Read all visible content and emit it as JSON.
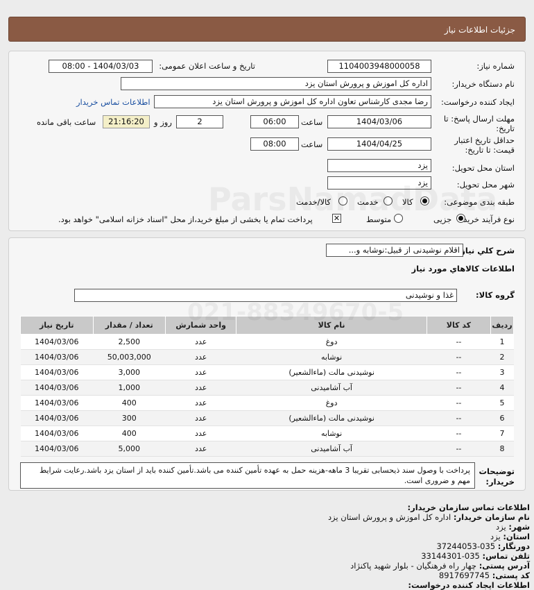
{
  "header": {
    "title": "جزئیات اطلاعات نیاز"
  },
  "form": {
    "need_number_label": "شماره نیاز:",
    "need_number": "1104003948000058",
    "announce_label": "تاریخ و ساعت اعلان عمومی:",
    "announce_value": "1404/03/03 - 08:00",
    "buyer_org_label": "نام دستگاه خریدار:",
    "buyer_org": "اداره کل اموزش و پرورش استان یزد",
    "creator_label": "ایجاد کننده درخواست:",
    "creator": "رضا مجدی کارشناس تعاون اداره کل اموزش و پرورش استان یزد",
    "contact_link": "اطلاعات تماس خریدار",
    "deadline_label_1": "مهلت ارسال پاسخ: تا",
    "deadline_label_2": "تاریخ:",
    "deadline_date": "1404/03/06",
    "time_label": "ساعت",
    "deadline_time": "06:00",
    "days": "2",
    "days_label": "روز و",
    "remaining": "21:16:20",
    "remaining_label": "ساعت باقی مانده",
    "validity_label_1": "حداقل تاریخ اعتبار",
    "validity_label_2": "قیمت: تا تاریخ:",
    "validity_date": "1404/04/25",
    "validity_time": "08:00",
    "province_label": "استان محل تحویل:",
    "province": "یزد",
    "city_label": "شهر محل تحویل:",
    "city": "یزد",
    "category_label": "طبقه بندی موضوعی:",
    "cat_goods": "کالا",
    "cat_service": "خدمت",
    "cat_both": "کالا/خدمت",
    "process_label": "نوع فرآیند خرید :",
    "proc_partial": "جزیی",
    "proc_medium": "متوسط",
    "payment_note": "پرداخت تمام یا بخشی از مبلغ خرید،از محل \"اسناد خزانه اسلامی\" خواهد بود."
  },
  "summary": {
    "desc_label": "شرح کلي نياز:",
    "desc_value": "اقلام نوشیدنی از قبیل:نوشابه و...",
    "items_title": "اطلاعات کالاهاي مورد نياز",
    "group_label": "گروه کالا:",
    "group_value": "غذا و نوشیدنی"
  },
  "table": {
    "headers": [
      "ردیف",
      "کد کالا",
      "نام کالا",
      "واحد شمارش",
      "تعداد / مقدار",
      "تاریخ نیاز"
    ],
    "rows": [
      [
        "1",
        "--",
        "دوغ",
        "عدد",
        "2,500",
        "1404/03/06"
      ],
      [
        "2",
        "--",
        "نوشابه",
        "عدد",
        "50,003,000",
        "1404/03/06"
      ],
      [
        "3",
        "--",
        "نوشیدنی مالت (ماءالشعیر)",
        "عدد",
        "3,000",
        "1404/03/06"
      ],
      [
        "4",
        "--",
        "آب آشامیدنی",
        "عدد",
        "1,000",
        "1404/03/06"
      ],
      [
        "5",
        "--",
        "دوغ",
        "عدد",
        "400",
        "1404/03/06"
      ],
      [
        "6",
        "--",
        "نوشیدنی مالت (ماءالشعیر)",
        "عدد",
        "300",
        "1404/03/06"
      ],
      [
        "7",
        "--",
        "نوشابه",
        "عدد",
        "400",
        "1404/03/06"
      ],
      [
        "8",
        "--",
        "آب آشامیدنی",
        "عدد",
        "5,000",
        "1404/03/06"
      ]
    ]
  },
  "notes": {
    "label_1": "توضیحات",
    "label_2": "خریدار:",
    "text": "پرداخت با وصول سند ذیحسابی تقریبا 3 ماهه-هزینه حمل به عهده تأمین کننده می باشد.تأمین کننده باید از استان یزد باشد.رعایت شرایط مهم و ضروری است."
  },
  "contact": {
    "title": "اطلاعات تماس سازمان خریدار:",
    "org_label": "نام سازمان خریدار:",
    "org": "اداره کل اموزش و پرورش استان یزد",
    "city_label": "شهر:",
    "city": "یزد",
    "province_label": "استان:",
    "province": "یزد",
    "fax_label": "دورنگار:",
    "fax": "035-37244053",
    "phone_label": "تلفن تماس:",
    "phone": "035-33144301",
    "address_label": "آدرس پستی:",
    "address": "چهار راه فرهنگیان - بلوار شهید پاکنژاد",
    "postal_label": "کد پستی:",
    "postal": "8917697745",
    "creator_info": "اطلاعات ایجاد کننده درخواست:"
  },
  "watermark": {
    "line1": "ParsNamadData",
    "line2": "021-88349670-5"
  }
}
